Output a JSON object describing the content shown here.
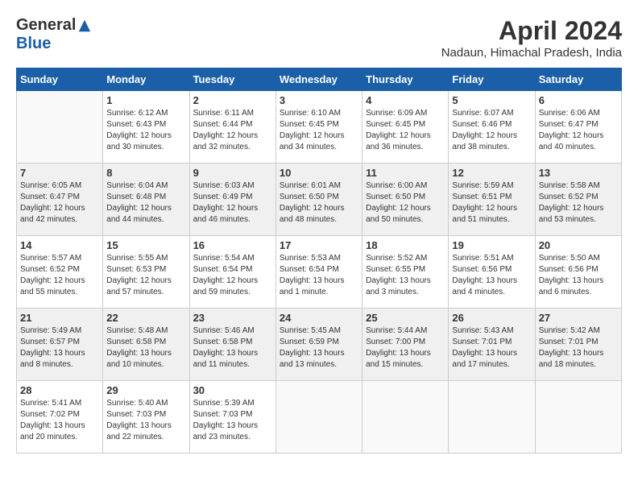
{
  "header": {
    "logo_general": "General",
    "logo_blue": "Blue",
    "month_year": "April 2024",
    "location": "Nadaun, Himachal Pradesh, India"
  },
  "weekdays": [
    "Sunday",
    "Monday",
    "Tuesday",
    "Wednesday",
    "Thursday",
    "Friday",
    "Saturday"
  ],
  "weeks": [
    [
      {
        "day": "",
        "sunrise": "",
        "sunset": "",
        "daylight": ""
      },
      {
        "day": "1",
        "sunrise": "Sunrise: 6:12 AM",
        "sunset": "Sunset: 6:43 PM",
        "daylight": "Daylight: 12 hours and 30 minutes."
      },
      {
        "day": "2",
        "sunrise": "Sunrise: 6:11 AM",
        "sunset": "Sunset: 6:44 PM",
        "daylight": "Daylight: 12 hours and 32 minutes."
      },
      {
        "day": "3",
        "sunrise": "Sunrise: 6:10 AM",
        "sunset": "Sunset: 6:45 PM",
        "daylight": "Daylight: 12 hours and 34 minutes."
      },
      {
        "day": "4",
        "sunrise": "Sunrise: 6:09 AM",
        "sunset": "Sunset: 6:45 PM",
        "daylight": "Daylight: 12 hours and 36 minutes."
      },
      {
        "day": "5",
        "sunrise": "Sunrise: 6:07 AM",
        "sunset": "Sunset: 6:46 PM",
        "daylight": "Daylight: 12 hours and 38 minutes."
      },
      {
        "day": "6",
        "sunrise": "Sunrise: 6:06 AM",
        "sunset": "Sunset: 6:47 PM",
        "daylight": "Daylight: 12 hours and 40 minutes."
      }
    ],
    [
      {
        "day": "7",
        "sunrise": "Sunrise: 6:05 AM",
        "sunset": "Sunset: 6:47 PM",
        "daylight": "Daylight: 12 hours and 42 minutes."
      },
      {
        "day": "8",
        "sunrise": "Sunrise: 6:04 AM",
        "sunset": "Sunset: 6:48 PM",
        "daylight": "Daylight: 12 hours and 44 minutes."
      },
      {
        "day": "9",
        "sunrise": "Sunrise: 6:03 AM",
        "sunset": "Sunset: 6:49 PM",
        "daylight": "Daylight: 12 hours and 46 minutes."
      },
      {
        "day": "10",
        "sunrise": "Sunrise: 6:01 AM",
        "sunset": "Sunset: 6:50 PM",
        "daylight": "Daylight: 12 hours and 48 minutes."
      },
      {
        "day": "11",
        "sunrise": "Sunrise: 6:00 AM",
        "sunset": "Sunset: 6:50 PM",
        "daylight": "Daylight: 12 hours and 50 minutes."
      },
      {
        "day": "12",
        "sunrise": "Sunrise: 5:59 AM",
        "sunset": "Sunset: 6:51 PM",
        "daylight": "Daylight: 12 hours and 51 minutes."
      },
      {
        "day": "13",
        "sunrise": "Sunrise: 5:58 AM",
        "sunset": "Sunset: 6:52 PM",
        "daylight": "Daylight: 12 hours and 53 minutes."
      }
    ],
    [
      {
        "day": "14",
        "sunrise": "Sunrise: 5:57 AM",
        "sunset": "Sunset: 6:52 PM",
        "daylight": "Daylight: 12 hours and 55 minutes."
      },
      {
        "day": "15",
        "sunrise": "Sunrise: 5:55 AM",
        "sunset": "Sunset: 6:53 PM",
        "daylight": "Daylight: 12 hours and 57 minutes."
      },
      {
        "day": "16",
        "sunrise": "Sunrise: 5:54 AM",
        "sunset": "Sunset: 6:54 PM",
        "daylight": "Daylight: 12 hours and 59 minutes."
      },
      {
        "day": "17",
        "sunrise": "Sunrise: 5:53 AM",
        "sunset": "Sunset: 6:54 PM",
        "daylight": "Daylight: 13 hours and 1 minute."
      },
      {
        "day": "18",
        "sunrise": "Sunrise: 5:52 AM",
        "sunset": "Sunset: 6:55 PM",
        "daylight": "Daylight: 13 hours and 3 minutes."
      },
      {
        "day": "19",
        "sunrise": "Sunrise: 5:51 AM",
        "sunset": "Sunset: 6:56 PM",
        "daylight": "Daylight: 13 hours and 4 minutes."
      },
      {
        "day": "20",
        "sunrise": "Sunrise: 5:50 AM",
        "sunset": "Sunset: 6:56 PM",
        "daylight": "Daylight: 13 hours and 6 minutes."
      }
    ],
    [
      {
        "day": "21",
        "sunrise": "Sunrise: 5:49 AM",
        "sunset": "Sunset: 6:57 PM",
        "daylight": "Daylight: 13 hours and 8 minutes."
      },
      {
        "day": "22",
        "sunrise": "Sunrise: 5:48 AM",
        "sunset": "Sunset: 6:58 PM",
        "daylight": "Daylight: 13 hours and 10 minutes."
      },
      {
        "day": "23",
        "sunrise": "Sunrise: 5:46 AM",
        "sunset": "Sunset: 6:58 PM",
        "daylight": "Daylight: 13 hours and 11 minutes."
      },
      {
        "day": "24",
        "sunrise": "Sunrise: 5:45 AM",
        "sunset": "Sunset: 6:59 PM",
        "daylight": "Daylight: 13 hours and 13 minutes."
      },
      {
        "day": "25",
        "sunrise": "Sunrise: 5:44 AM",
        "sunset": "Sunset: 7:00 PM",
        "daylight": "Daylight: 13 hours and 15 minutes."
      },
      {
        "day": "26",
        "sunrise": "Sunrise: 5:43 AM",
        "sunset": "Sunset: 7:01 PM",
        "daylight": "Daylight: 13 hours and 17 minutes."
      },
      {
        "day": "27",
        "sunrise": "Sunrise: 5:42 AM",
        "sunset": "Sunset: 7:01 PM",
        "daylight": "Daylight: 13 hours and 18 minutes."
      }
    ],
    [
      {
        "day": "28",
        "sunrise": "Sunrise: 5:41 AM",
        "sunset": "Sunset: 7:02 PM",
        "daylight": "Daylight: 13 hours and 20 minutes."
      },
      {
        "day": "29",
        "sunrise": "Sunrise: 5:40 AM",
        "sunset": "Sunset: 7:03 PM",
        "daylight": "Daylight: 13 hours and 22 minutes."
      },
      {
        "day": "30",
        "sunrise": "Sunrise: 5:39 AM",
        "sunset": "Sunset: 7:03 PM",
        "daylight": "Daylight: 13 hours and 23 minutes."
      },
      {
        "day": "",
        "sunrise": "",
        "sunset": "",
        "daylight": ""
      },
      {
        "day": "",
        "sunrise": "",
        "sunset": "",
        "daylight": ""
      },
      {
        "day": "",
        "sunrise": "",
        "sunset": "",
        "daylight": ""
      },
      {
        "day": "",
        "sunrise": "",
        "sunset": "",
        "daylight": ""
      }
    ]
  ]
}
